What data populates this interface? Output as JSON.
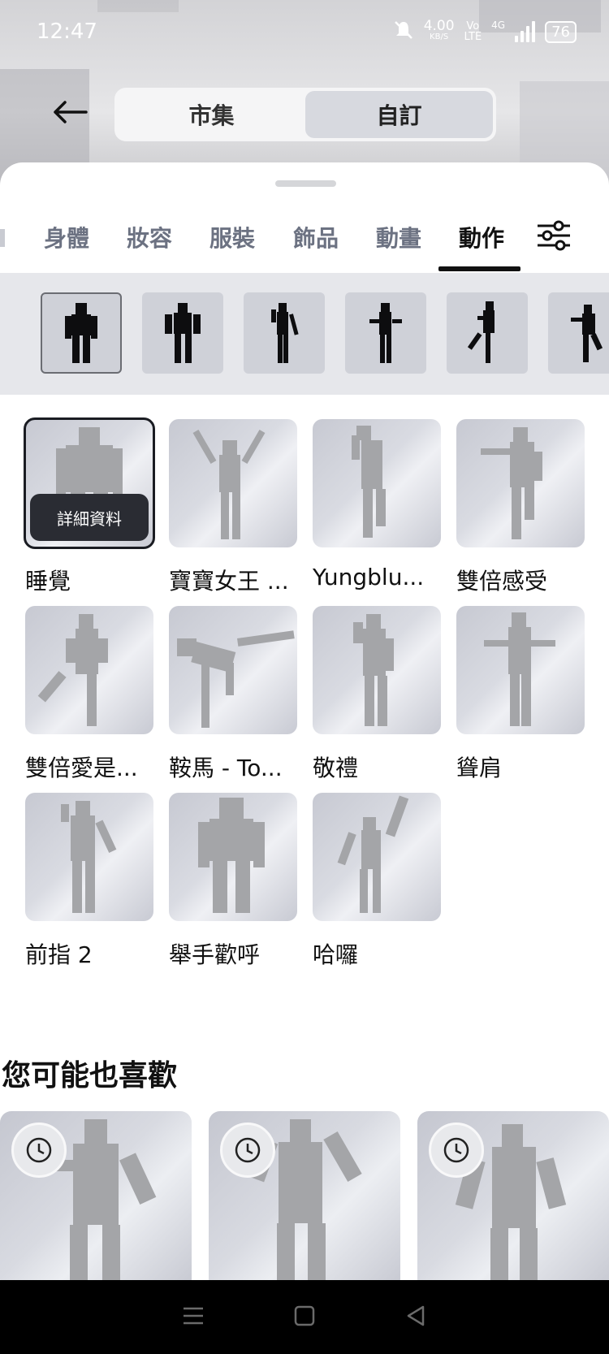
{
  "status_bar": {
    "time": "12:47",
    "net_speed": "4.00",
    "net_speed_unit": "KB/S",
    "volte_top": "Vo",
    "volte_bottom": "LTE",
    "network": "4G",
    "battery": "76"
  },
  "header": {
    "back_icon": "arrow-left-icon",
    "segments": [
      {
        "label": "市集",
        "active": false
      },
      {
        "label": "自訂",
        "active": true
      }
    ]
  },
  "category_tabs": [
    {
      "label": "身體",
      "active": false
    },
    {
      "label": "妝容",
      "active": false
    },
    {
      "label": "服裝",
      "active": false
    },
    {
      "label": "飾品",
      "active": false
    },
    {
      "label": "動畫",
      "active": false
    },
    {
      "label": "動作",
      "active": true
    }
  ],
  "filter_icon": "sliders-icon",
  "pose_strip_count_visible": 6,
  "grid": {
    "detail_button_label": "詳細資料",
    "items": [
      {
        "label": "睡覺",
        "selected": true
      },
      {
        "label": "寶寶女王 ..."
      },
      {
        "label": "Yungblu..."
      },
      {
        "label": "雙倍感受"
      },
      {
        "label": "雙倍愛是..."
      },
      {
        "label": "鞍馬 - To..."
      },
      {
        "label": "敬禮"
      },
      {
        "label": "聳肩"
      },
      {
        "label": "前指 2"
      },
      {
        "label": "舉手歡呼"
      },
      {
        "label": "哈囉"
      }
    ]
  },
  "recommendations": {
    "title": "您可能也喜歡",
    "badge_icon": "clock-icon"
  },
  "colors": {
    "accent": "#111111",
    "tab_inactive": "#6c7282",
    "detail_button_bg": "#2a2c33"
  }
}
